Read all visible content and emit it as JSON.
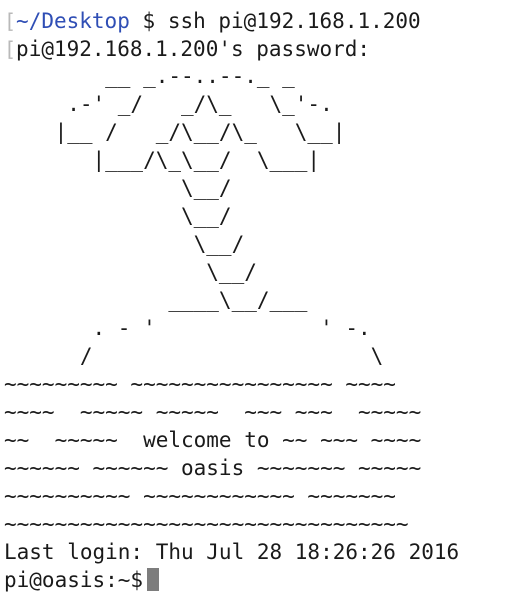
{
  "terminal": {
    "command_line": {
      "marker": "[",
      "path": "~/Desktop",
      "prompt_symbol": "$",
      "command": "ssh pi@192.168.1.200"
    },
    "password_line": {
      "marker": "[",
      "text": "pi@192.168.1.200's password:"
    },
    "motd_lines": [
      "        __ _.--..--._ _",
      "     .-' _/   _/\\_   \\_'-.",
      "    |__ /   _/\\__/\\_   \\__|",
      "       |___/\\_\\__/  \\___|",
      "              \\__/",
      "              \\__/",
      "               \\__/",
      "                \\__/",
      "             ____\\__/___",
      "       . - '             ' -.",
      "      /                      \\",
      "~~~~~~~~~ ~~~~~~~~~~~~~~~~ ~~~~",
      "~~~~  ~~~~~ ~~~~~  ~~~ ~~~  ~~~~~",
      "~~  ~~~~~  welcome to ~~ ~~~ ~~~~",
      "~~~~~~ ~~~~~~ oasis ~~~~~~~ ~~~~~",
      "~~~~~~~~~~ ~~~~~~~~~~~~ ~~~~~~~",
      "~~~~~~~~~~~~~~~~~~~~~~~~~~~~~~~~"
    ],
    "last_login": "Last login: Thu Jul 28 18:26:26 2016",
    "remote_prompt": "pi@oasis:~$"
  }
}
